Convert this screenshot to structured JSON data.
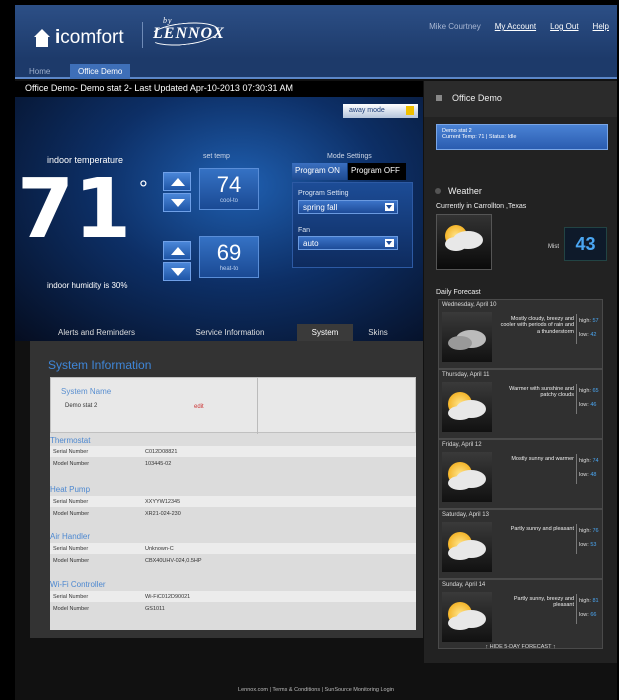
{
  "header": {
    "brand_i": "i",
    "brand_rest": "comfort",
    "by": "by",
    "lennox": "LENNOX",
    "links": {
      "user": "Mike Courtney",
      "account": "My Account",
      "logout": "Log Out",
      "help": "Help"
    }
  },
  "tabs": {
    "home": "Home",
    "active": "Office Demo"
  },
  "status_bar": "Office Demo- Demo stat 2- Last Updated Apr-10-2013 07:30:31 AM",
  "away_mode": "away mode",
  "indoor": {
    "label": "indoor temperature",
    "temp": "71",
    "degree": "°",
    "humidity": "indoor humidity is 30%"
  },
  "set_temp": {
    "label": "set temp",
    "cool_value": "74",
    "cool_label": "cool-to",
    "heat_value": "69",
    "heat_label": "heat-to"
  },
  "mode": {
    "label": "Mode Settings",
    "program_on": "Program ON",
    "program_off": "Program OFF",
    "program_setting_label": "Program Setting",
    "program_setting_value": "spring fall",
    "fan_label": "Fan",
    "fan_value": "auto"
  },
  "bottom_tabs": [
    "Alerts and Reminders",
    "Service Information",
    "System",
    "Skins"
  ],
  "system": {
    "title": "System Information",
    "system_name_label": "System Name",
    "system_name_value": "Demo stat 2",
    "edit": "edit",
    "sections": [
      {
        "title": "Thermostat",
        "rows": [
          {
            "k": "Serial Number",
            "v": "C012D08821"
          },
          {
            "k": "Model Number",
            "v": "103445-02"
          }
        ]
      },
      {
        "title": "Heat Pump",
        "rows": [
          {
            "k": "Serial Number",
            "v": "XXYYW12345"
          },
          {
            "k": "Model Number",
            "v": "XR21-024-230"
          }
        ]
      },
      {
        "title": "Air Handler",
        "rows": [
          {
            "k": "Serial Number",
            "v": "Unknown-C"
          },
          {
            "k": "Model Number",
            "v": "CBX40UHV-024,0.5HP"
          }
        ]
      },
      {
        "title": "Wi-Fi Controller",
        "rows": [
          {
            "k": "Serial Number",
            "v": "Wi-FiC012D90021"
          },
          {
            "k": "Model Number",
            "v": "GS1011"
          }
        ]
      }
    ]
  },
  "right": {
    "title": "Office Demo",
    "stat_name": "Demo stat 2",
    "stat_current": "Current Temp: 71",
    "stat_status": "Status: Idle",
    "weather_title": "Weather",
    "currently": "Currently in Carrollton ,Texas",
    "condition": "Mist",
    "current_temp": "43",
    "daily_title": "Daily Forecast",
    "days": [
      {
        "name": "Wednesday, April 10",
        "desc": "Mostly cloudy, breezy and cooler with periods of rain and a thunderstorm",
        "high": "57",
        "low": "42",
        "type": "storm"
      },
      {
        "name": "Thursday, April 11",
        "desc": "Warmer with sunshine and patchy clouds",
        "high": "65",
        "low": "46",
        "type": "partly"
      },
      {
        "name": "Friday, April 12",
        "desc": "Mostly sunny and warmer",
        "high": "74",
        "low": "48",
        "type": "partly"
      },
      {
        "name": "Saturday, April 13",
        "desc": "Partly sunny and pleasant",
        "high": "76",
        "low": "53",
        "type": "partly"
      },
      {
        "name": "Sunday, April 14",
        "desc": "Partly sunny, breezy and pleasant",
        "high": "81",
        "low": "66",
        "type": "partly"
      }
    ],
    "hide_link": "↑ HIDE 5-DAY FORECAST ↑",
    "high_label": "high:",
    "low_label": "low:"
  },
  "footer": "Lennox.com | Terms & Conditions | SunSource Monitoring Login"
}
